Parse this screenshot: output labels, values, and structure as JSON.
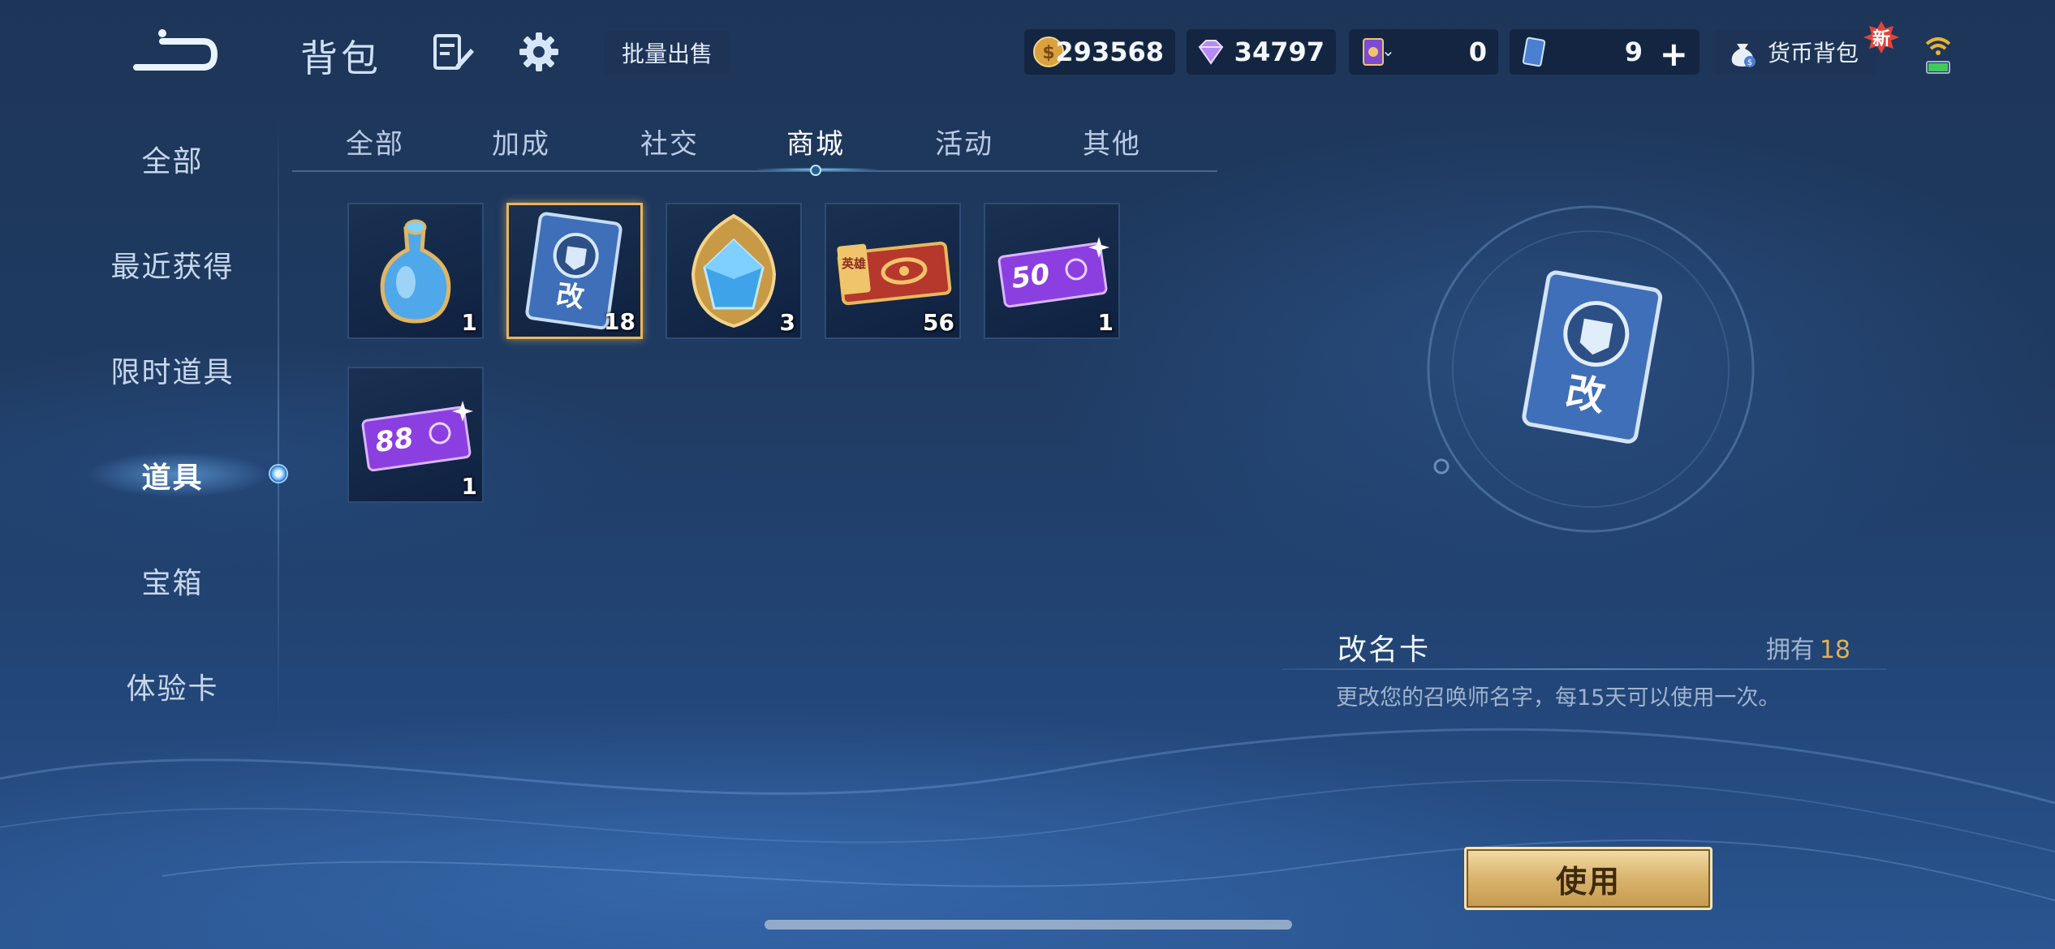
{
  "header": {
    "title": "背包",
    "bulk_sell_label": "批量出售",
    "currencies": [
      {
        "icon": "gold-coin-icon",
        "value": "293568"
      },
      {
        "icon": "diamond-icon",
        "value": "34797"
      },
      {
        "icon": "purple-card-icon",
        "value": "0"
      },
      {
        "icon": "blue-card-icon",
        "value": "9"
      }
    ],
    "wallet_label": "货币背包",
    "new_badge": "新"
  },
  "sidebar": {
    "items": [
      {
        "label": "全部"
      },
      {
        "label": "最近获得"
      },
      {
        "label": "限时道具"
      },
      {
        "label": "道具",
        "active": true
      },
      {
        "label": "宝箱"
      },
      {
        "label": "体验卡"
      }
    ]
  },
  "tabs": [
    {
      "label": "全部"
    },
    {
      "label": "加成"
    },
    {
      "label": "社交"
    },
    {
      "label": "商城",
      "active": true
    },
    {
      "label": "活动"
    },
    {
      "label": "其他"
    }
  ],
  "items": [
    {
      "icon": "blue-potion-icon",
      "qty": "1"
    },
    {
      "icon": "rename-card-icon",
      "qty": "18",
      "selected": true,
      "glyph": "改"
    },
    {
      "icon": "gem-crest-icon",
      "qty": "3"
    },
    {
      "icon": "hero-ticket-icon",
      "qty": "56",
      "glyph": "英雄"
    },
    {
      "icon": "purple-ticket-icon",
      "qty": "1",
      "glyph": "50"
    },
    {
      "icon": "purple-ticket-icon",
      "qty": "1",
      "glyph": "88"
    }
  ],
  "detail": {
    "name": "改名卡",
    "owned_label": "拥有",
    "owned_count": "18",
    "description": "更改您的召唤师名字，每15天可以使用一次。",
    "use_button": "使用",
    "card_glyph": "改"
  },
  "colors": {
    "accent_gold": "#e3b04f",
    "selected_border": "#e8b65a",
    "background": "#1f3b62"
  }
}
